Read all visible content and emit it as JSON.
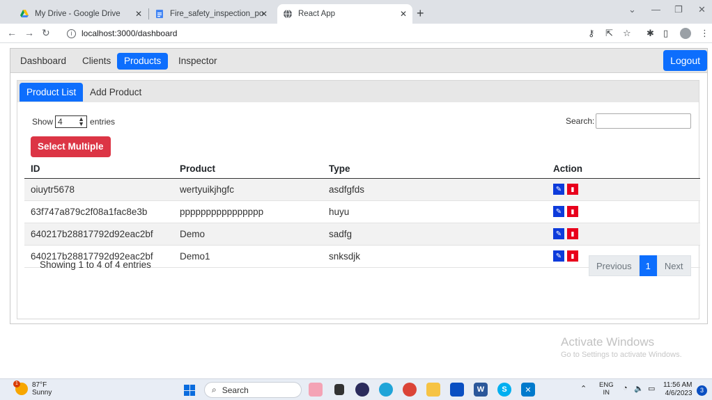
{
  "browser": {
    "tabs": [
      {
        "title": "My Drive - Google Drive",
        "icon": "google-drive-icon"
      },
      {
        "title": "Fire_safety_inspection_portal - Go",
        "icon": "google-docs-icon"
      },
      {
        "title": "React App",
        "icon": "globe-icon"
      }
    ],
    "url": "localhost:3000/dashboard"
  },
  "nav": {
    "items": [
      "Dashboard",
      "Clients",
      "Products",
      "Inspector"
    ],
    "active": "Products",
    "logout": "Logout"
  },
  "subnav": {
    "items": [
      "Product List",
      "Add Product"
    ],
    "active": "Product List"
  },
  "controls": {
    "show_label": "Show",
    "entries_value": "4",
    "entries_label": "entries",
    "search_label": "Search:",
    "search_value": "",
    "select_multiple": "Select Multiple"
  },
  "table": {
    "headers": [
      "ID",
      "Product",
      "Type",
      "Action"
    ],
    "rows": [
      [
        "oiuytr5678",
        "wertyuikjhgfc",
        "asdfgfds"
      ],
      [
        "63f747a879c2f08a1fac8e3b",
        "pppppppppppppppp",
        "huyu"
      ],
      [
        "640217b28817792d92eac2bf",
        "Demo",
        "sadfg"
      ],
      [
        "640217b28817792d92eac2bf",
        "Demo1",
        "snksdjk"
      ]
    ]
  },
  "footer": {
    "info": "Showing 1 to 4 of 4 entries",
    "previous": "Previous",
    "page": "1",
    "next": "Next"
  },
  "watermark": {
    "line1": "Activate Windows",
    "line2": "Go to Settings to activate Windows."
  },
  "taskbar": {
    "temp": "87°F",
    "weather": "Sunny",
    "weather_badge": "1",
    "search": "Search",
    "lang1": "ENG",
    "lang2": "IN",
    "time": "11:56 AM",
    "date": "4/6/2023",
    "notifications": "3"
  },
  "colors": {
    "primary": "#0d6efd",
    "danger": "#dc3545",
    "edit": "#0d3bdb",
    "delete": "#e8001c"
  }
}
